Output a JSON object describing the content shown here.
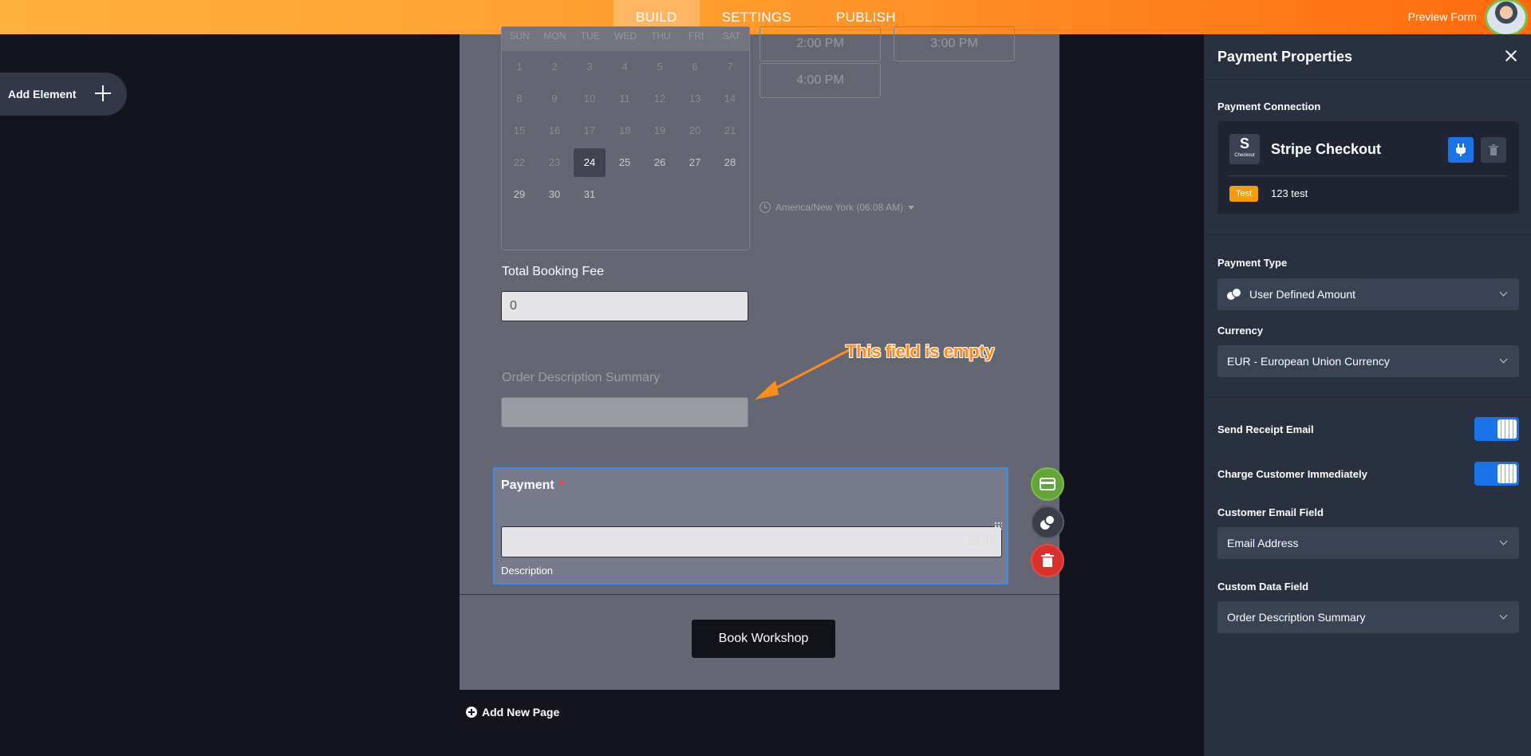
{
  "topbar": {
    "tabs": [
      "BUILD",
      "SETTINGS",
      "PUBLISH"
    ],
    "active_tab": "BUILD",
    "preview_label": "Preview Form"
  },
  "add_element_label": "Add Element",
  "calendar": {
    "weekdays": [
      "SUN",
      "MON",
      "TUE",
      "WED",
      "THU",
      "FRI",
      "SAT"
    ],
    "days": [
      "1",
      "2",
      "3",
      "4",
      "5",
      "6",
      "7",
      "8",
      "9",
      "10",
      "11",
      "12",
      "13",
      "14",
      "15",
      "16",
      "17",
      "18",
      "19",
      "20",
      "21",
      "22",
      "23",
      "24",
      "25",
      "26",
      "27",
      "28",
      "29",
      "30",
      "31"
    ],
    "selected_day": "24"
  },
  "time_slots": [
    "2:00 PM",
    "3:00 PM",
    "4:00 PM"
  ],
  "timezone": "America/New York (06:08 AM)",
  "total_booking_fee": {
    "label": "Total Booking Fee",
    "value": "0"
  },
  "order_description": {
    "label": "Order Description Summary",
    "value": ""
  },
  "annotation": "This field is empty",
  "payment": {
    "title": "Payment",
    "required_mark": "*",
    "currency_suffix": "EUR",
    "description_label": "Description"
  },
  "submit_label": "Book Workshop",
  "add_page_label": "Add New Page",
  "panel": {
    "title": "Payment Properties",
    "connection_label": "Payment Connection",
    "connection_name": "Stripe Checkout",
    "logo_letter": "S",
    "logo_caption": "Checkout",
    "badge": "Test",
    "connection_sub": "123 test",
    "payment_type_label": "Payment Type",
    "payment_type_value": "User Defined Amount",
    "currency_label": "Currency",
    "currency_value": "EUR - European Union Currency",
    "send_receipt_label": "Send Receipt Email",
    "charge_label": "Charge Customer Immediately",
    "email_field_label": "Customer Email Field",
    "email_field_value": "Email Address",
    "custom_data_label": "Custom Data Field",
    "custom_data_value": "Order Description Summary"
  },
  "colors": {
    "accent": "#1a73e8",
    "topbar_start": "#ffb23c",
    "topbar_end": "#ff6a0d",
    "annotation": "#ff8c1a"
  }
}
